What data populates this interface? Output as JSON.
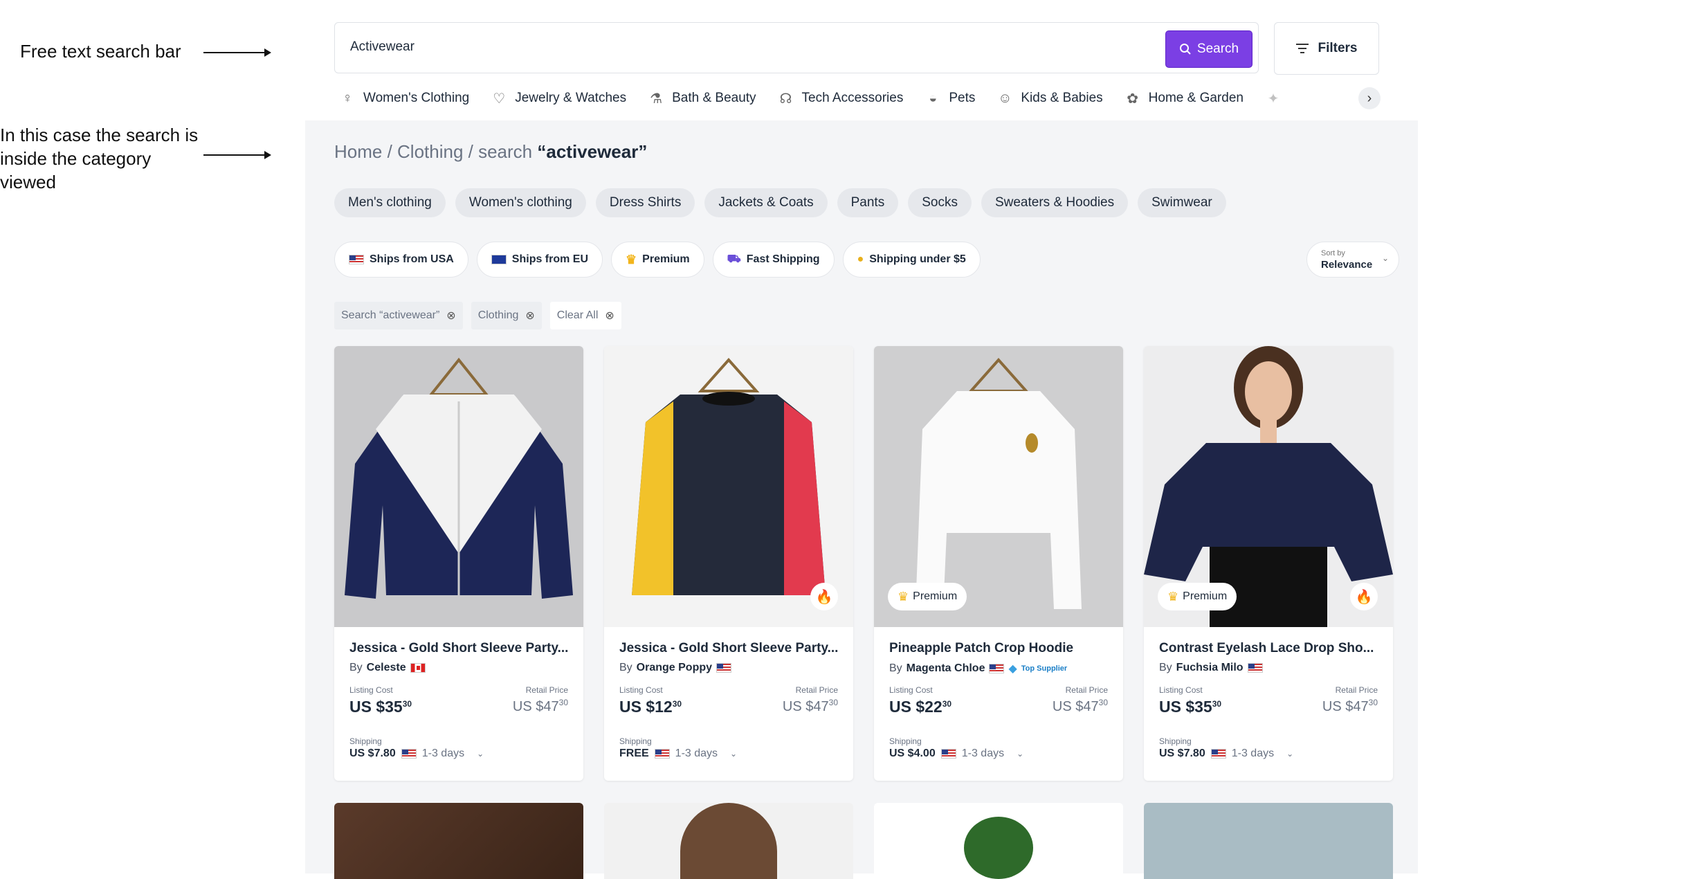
{
  "annotations": {
    "search": "Free text search bar",
    "category_line1": "In this case the search is",
    "category_line2": "inside the category",
    "category_line3": "viewed"
  },
  "search": {
    "value": "Activewear",
    "button_label": "Search"
  },
  "filters_label": "Filters",
  "categories": [
    {
      "label": "Women's Clothing",
      "icon": "dress-icon"
    },
    {
      "label": "Jewelry & Watches",
      "icon": "necklace-icon"
    },
    {
      "label": "Bath & Beauty",
      "icon": "lotion-icon"
    },
    {
      "label": "Tech Accessories",
      "icon": "headphones-icon"
    },
    {
      "label": "Pets",
      "icon": "pet-bowl-icon"
    },
    {
      "label": "Kids & Babies",
      "icon": "baby-bib-icon"
    },
    {
      "label": "Home & Garden",
      "icon": "plant-icon"
    }
  ],
  "breadcrumb": {
    "path": "Home / Clothing / search ",
    "query": "“activewear”"
  },
  "subcategories": [
    "Men's clothing",
    "Women's clothing",
    "Dress Shirts",
    "Jackets & Coats",
    "Pants",
    "Socks",
    "Sweaters & Hoodies",
    "Swimwear"
  ],
  "quick_filters": [
    "Ships from USA",
    "Ships from EU",
    "Premium",
    "Fast Shipping",
    "Shipping under $5"
  ],
  "sort": {
    "label": "Sort by",
    "value": "Relevance"
  },
  "active_filters": [
    "Search “activewear”",
    "Clothing",
    "Clear All"
  ],
  "products": [
    {
      "title": "Jessica - Gold Short Sleeve Party...",
      "by": "By",
      "seller": "Celeste",
      "flag": "CA",
      "listing_label": "Listing Cost",
      "listing": "US $35",
      "listing_cents": "30",
      "retail_label": "Retail Price",
      "retail": "US $47",
      "retail_cents": "30",
      "shipping_label": "Shipping",
      "shipping": "US $7.80",
      "days": "1-3 days",
      "premium": "",
      "hot": false
    },
    {
      "title": "Jessica - Gold Short Sleeve Party...",
      "by": "By",
      "seller": "Orange Poppy",
      "flag": "US",
      "listing_label": "Listing Cost",
      "listing": "US $12",
      "listing_cents": "30",
      "retail_label": "Retail Price",
      "retail": "US $47",
      "retail_cents": "30",
      "shipping_label": "Shipping",
      "shipping": "FREE",
      "days": "1-3 days",
      "premium": "",
      "hot": true
    },
    {
      "title": "Pineapple Patch Crop Hoodie",
      "by": "By",
      "seller": "Magenta Chloe",
      "flag": "US",
      "top_supplier": "Top Supplier",
      "listing_label": "Listing Cost",
      "listing": "US $22",
      "listing_cents": "30",
      "retail_label": "Retail Price",
      "retail": "US $47",
      "retail_cents": "30",
      "shipping_label": "Shipping",
      "shipping": "US $4.00",
      "days": "1-3 days",
      "premium": "Premium",
      "hot": false
    },
    {
      "title": "Contrast Eyelash Lace Drop Sho...",
      "by": "By",
      "seller": "Fuchsia Milo",
      "flag": "US",
      "listing_label": "Listing Cost",
      "listing": "US $35",
      "listing_cents": "30",
      "retail_label": "Retail Price",
      "retail": "US $47",
      "retail_cents": "30",
      "shipping_label": "Shipping",
      "shipping": "US $7.80",
      "days": "1-3 days",
      "premium": "Premium",
      "hot": true
    }
  ],
  "colors": {
    "accent": "#7b3fe4",
    "background": "#f4f5f7"
  }
}
